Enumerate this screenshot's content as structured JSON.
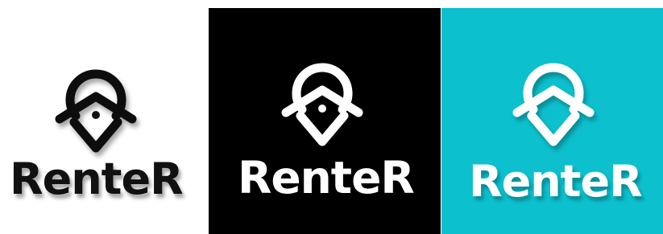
{
  "brand": {
    "name": "RenteR"
  },
  "icon": "location-pin-house-icon",
  "variants": [
    {
      "label": "white",
      "background": "#ffffff",
      "foreground": "#111111"
    },
    {
      "label": "black",
      "background": "#000000",
      "foreground": "#ffffff"
    },
    {
      "label": "teal",
      "background": "#0cc0ce",
      "foreground": "#ffffff"
    }
  ]
}
